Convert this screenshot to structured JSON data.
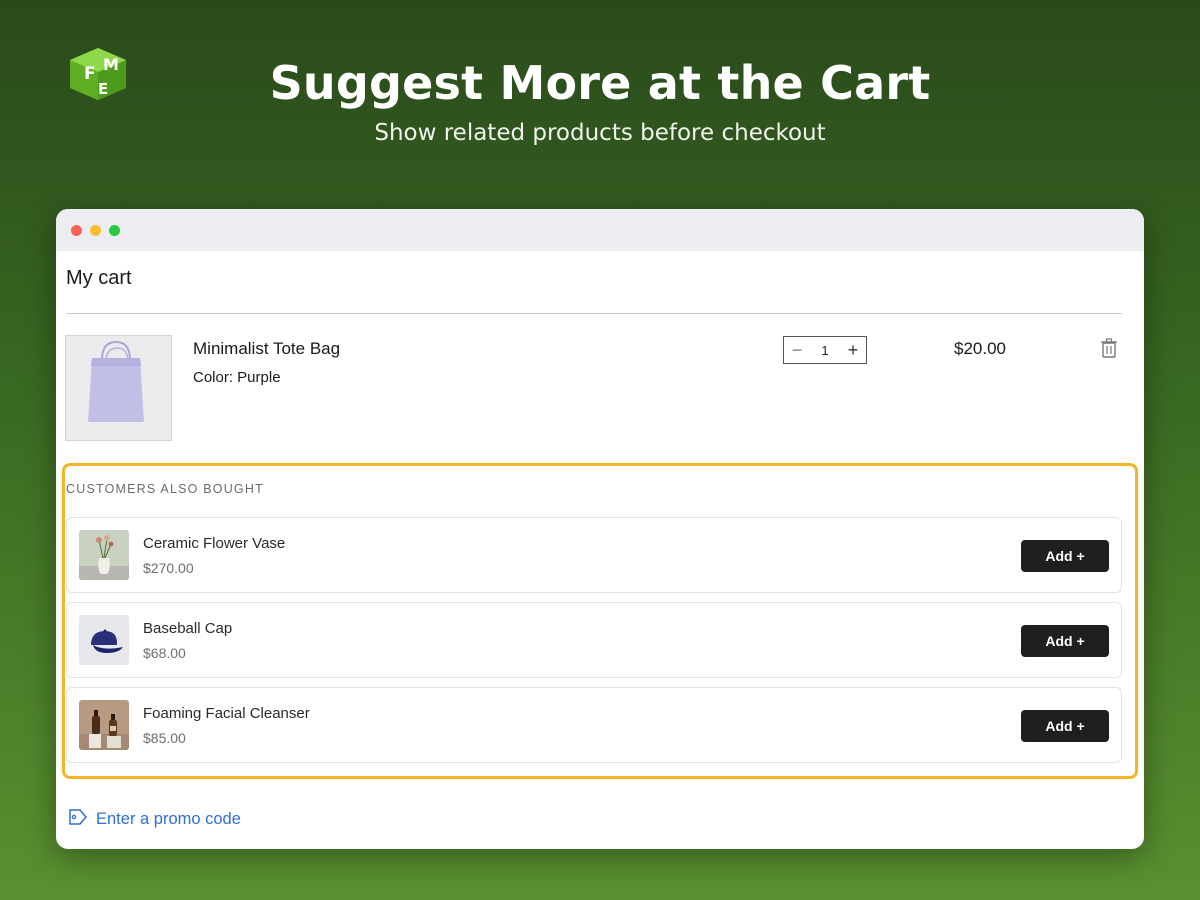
{
  "banner": {
    "headline": "Suggest More at the Cart",
    "subline": "Show related products before checkout",
    "logo_letters": [
      "F",
      "M",
      "E"
    ]
  },
  "cart": {
    "title": "My cart",
    "item": {
      "name": "Minimalist Tote Bag",
      "color": "Color: Purple",
      "quantity": "1",
      "price": "$20.00",
      "qty_minus": "−",
      "qty_plus": "+"
    }
  },
  "suggestions": {
    "title": "CUSTOMERS ALSO BOUGHT",
    "add_label": "Add +",
    "items": [
      {
        "name": "Ceramic Flower Vase",
        "price": "$270.00",
        "icon": "vase-thumbnail"
      },
      {
        "name": "Baseball Cap",
        "price": "$68.00",
        "icon": "cap-thumbnail"
      },
      {
        "name": "Foaming Facial Cleanser",
        "price": "$85.00",
        "icon": "cleanser-thumbnail"
      }
    ]
  },
  "promo": {
    "label": "Enter a promo code",
    "icon": "tag-icon"
  },
  "colors": {
    "highlight_border": "#f2b52a",
    "add_button": "#1f1f1f",
    "promo_link": "#2f6ed6",
    "background_top": "#2a4a1b",
    "background_bottom": "#5a9030"
  }
}
